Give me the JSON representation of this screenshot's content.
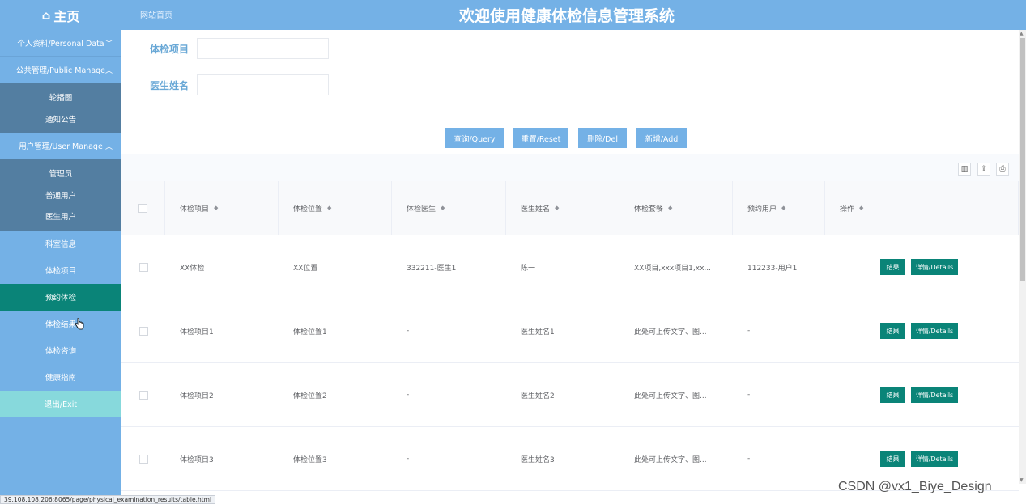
{
  "header": {
    "home_label": "主页",
    "site_link": "网站首页",
    "title": "欢迎使用健康体检信息管理系统"
  },
  "sidebar": {
    "personal_data": "个人资料/Personal Data",
    "public_manage": "公共管理/Public Manage",
    "public_items": [
      "轮播图",
      "通知公告"
    ],
    "user_manage": "用户管理/User Manage",
    "user_items": [
      "管理员",
      "普通用户",
      "医生用户"
    ],
    "items": [
      "科室信息",
      "体检项目",
      "预约体检",
      "体检结果",
      "体检咨询",
      "健康指南"
    ],
    "active_item": "预约体检",
    "exit": "退出/Exit"
  },
  "search": {
    "item_label": "体检项目",
    "item_value": "",
    "doctor_label": "医生姓名",
    "doctor_value": ""
  },
  "buttons": {
    "query": "查询/Query",
    "reset": "重置/Reset",
    "delete": "删除/Del",
    "add": "新增/Add"
  },
  "table": {
    "columns": [
      "体检项目",
      "体检位置",
      "体检医生",
      "医生姓名",
      "体检套餐",
      "预约用户",
      "操作"
    ],
    "rows": [
      [
        "XX体检",
        "XX位置",
        "332211-医生1",
        "陈一",
        "XX项目,xxx项目1,xx...",
        "112233-用户1"
      ],
      [
        "体检项目1",
        "体检位置1",
        "-",
        "医生姓名1",
        "此处可上传文字、图...",
        "-"
      ],
      [
        "体检项目2",
        "体检位置2",
        "-",
        "医生姓名2",
        "此处可上传文字、图...",
        "-"
      ],
      [
        "体检项目3",
        "体检位置3",
        "-",
        "医生姓名3",
        "此处可上传文字、图...",
        "-"
      ]
    ],
    "result_label": "结果",
    "details_label": "详情/Details"
  },
  "status_url": "39.108.108.206:8065/page/physical_examination_results/table.html",
  "watermark": "CSDN @vx1_Biye_Design",
  "colors": {
    "primary": "#74b1e6",
    "active": "#0a8478",
    "submenu": "#537ea1",
    "exit": "#87d9dc"
  }
}
